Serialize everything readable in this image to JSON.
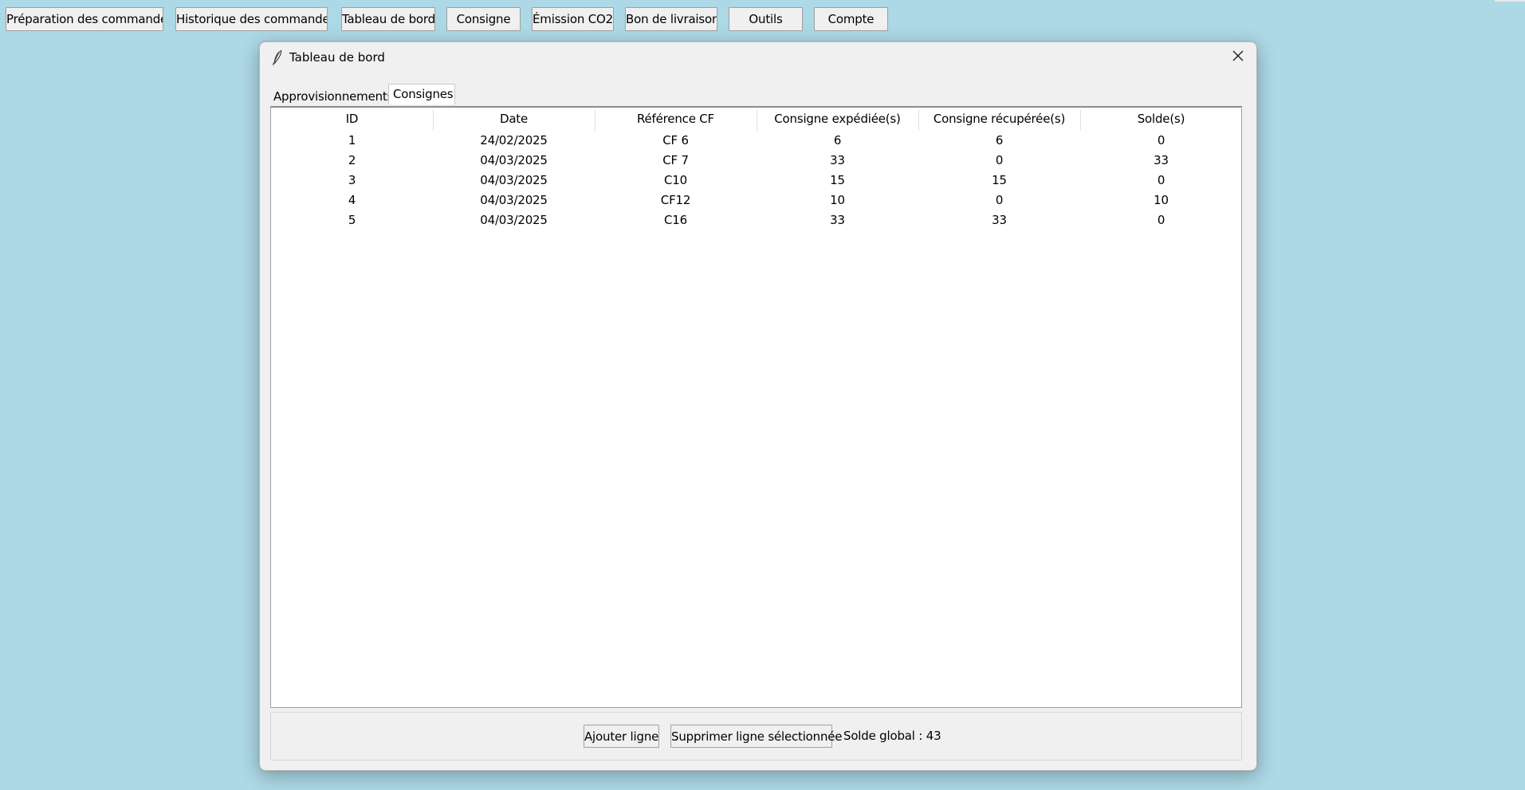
{
  "topbar": {
    "buttons": [
      {
        "label": "Préparation des commandes"
      },
      {
        "label": "Historique des commandes"
      },
      {
        "label": "Tableau de bord"
      },
      {
        "label": "Consigne"
      },
      {
        "label": "Émission CO2"
      },
      {
        "label": "Bon de livraison"
      },
      {
        "label": "Outils"
      },
      {
        "label": "Compte"
      }
    ]
  },
  "window": {
    "title": "Tableau de bord",
    "icon": "feather-icon",
    "close_icon": "close-icon"
  },
  "tabs": [
    {
      "label": "Approvisionnements",
      "active": false
    },
    {
      "label": "Consignes",
      "active": true
    }
  ],
  "table": {
    "columns": [
      "ID",
      "Date",
      "Référence CF",
      "Consigne expédiée(s)",
      "Consigne récupérée(s)",
      "Solde(s)"
    ],
    "rows": [
      [
        "1",
        "24/02/2025",
        "CF 6",
        "6",
        "6",
        "0"
      ],
      [
        "2",
        "04/03/2025",
        "CF 7",
        "33",
        "0",
        "33"
      ],
      [
        "3",
        "04/03/2025",
        "C10",
        "15",
        "15",
        "0"
      ],
      [
        "4",
        "04/03/2025",
        "CF12",
        "10",
        "0",
        "10"
      ],
      [
        "5",
        "04/03/2025",
        "C16",
        "33",
        "33",
        "0"
      ]
    ]
  },
  "actions": {
    "add_label": "Ajouter ligne",
    "delete_label": "Supprimer ligne sélectionnée",
    "solde_text": "Solde global : 43"
  },
  "colors": {
    "desktop": "#add8e6",
    "window": "#f0f0f0",
    "table_bg": "#ffffff"
  }
}
